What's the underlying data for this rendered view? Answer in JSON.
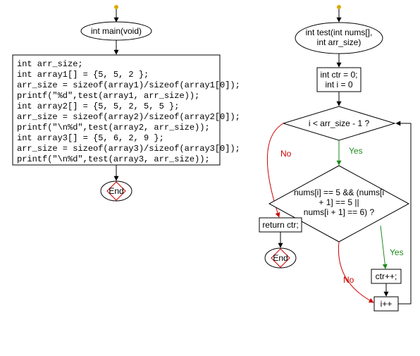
{
  "left": {
    "start": "int main(void)",
    "code": [
      "int arr_size;",
      "int array1[] = {5, 5, 2 };",
      "arr_size = sizeof(array1)/sizeof(array1[0]);",
      "printf(\"%d\",test(array1, arr_size));",
      "int array2[] = {5, 5, 2, 5, 5 };",
      "arr_size = sizeof(array2)/sizeof(array2[0]);",
      "printf(\"\\n%d\",test(array2, arr_size));",
      "int array3[] = {5, 6, 2, 9 };",
      "arr_size = sizeof(array3)/sizeof(array3[0]);",
      "printf(\"\\n%d\",test(array3, arr_size));"
    ],
    "end": "End"
  },
  "right": {
    "start1": "int test(int nums[],",
    "start2": "int arr_size)",
    "init1": "int ctr = 0;",
    "init2": "int i = 0",
    "cond1": "i < arr_size - 1 ?",
    "cond2a": "nums[i] == 5 && (nums[i",
    "cond2b": "+ 1] == 5 ||",
    "cond2c": "nums[i + 1] == 6) ?",
    "return": "return ctr;",
    "inc": "ctr++;",
    "iinc": "i++",
    "end": "End",
    "label_no": "No",
    "label_yes": "Yes"
  }
}
